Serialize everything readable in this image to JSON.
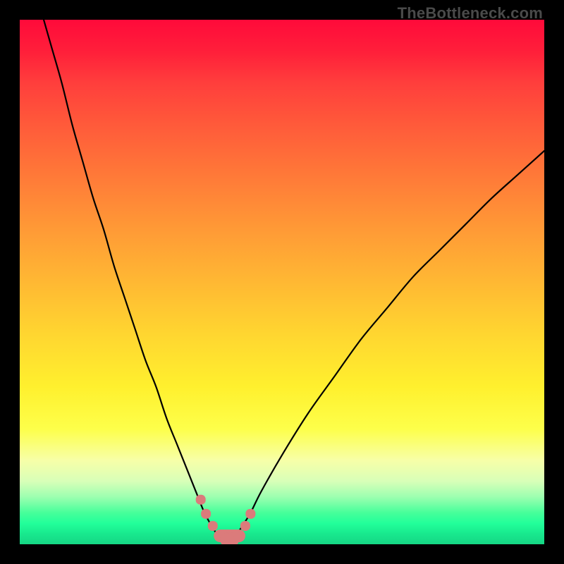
{
  "watermark": "TheBottleneck.com",
  "chart_data": {
    "type": "line",
    "title": "",
    "xlabel": "",
    "ylabel": "",
    "xlim": [
      0,
      100
    ],
    "ylim": [
      0,
      100
    ],
    "series": [
      {
        "name": "bottleneck-curve",
        "x": [
          4,
          6,
          8,
          10,
          12,
          14,
          16,
          18,
          20,
          22,
          24,
          26,
          28,
          30,
          32,
          34,
          35,
          36,
          37,
          38,
          39,
          40,
          41,
          42,
          44,
          46,
          50,
          55,
          60,
          65,
          70,
          75,
          80,
          85,
          90,
          95,
          100
        ],
        "values": [
          102,
          95,
          88,
          80,
          73,
          66,
          60,
          53,
          47,
          41,
          35,
          30,
          24,
          19,
          14,
          9,
          6.5,
          4.5,
          2.8,
          1.5,
          0.8,
          0.8,
          1.5,
          2.8,
          6,
          10,
          17,
          25,
          32,
          39,
          45,
          51,
          56,
          61,
          66,
          70.5,
          75
        ]
      }
    ],
    "markers": {
      "name": "highlighted-points",
      "color": "#db7b7b",
      "x": [
        34.5,
        35.5,
        36.8,
        38.2,
        39.5,
        40.5,
        41.8,
        43.0,
        44.0
      ],
      "values": [
        8.5,
        5.8,
        3.5,
        1.6,
        0.9,
        0.9,
        1.6,
        3.5,
        5.8
      ]
    },
    "background_gradient": {
      "top": "#ff0a3a",
      "mid_high": "#ff9a36",
      "mid": "#fff02e",
      "mid_low": "#9cffb0",
      "bottom": "#15d684"
    }
  }
}
